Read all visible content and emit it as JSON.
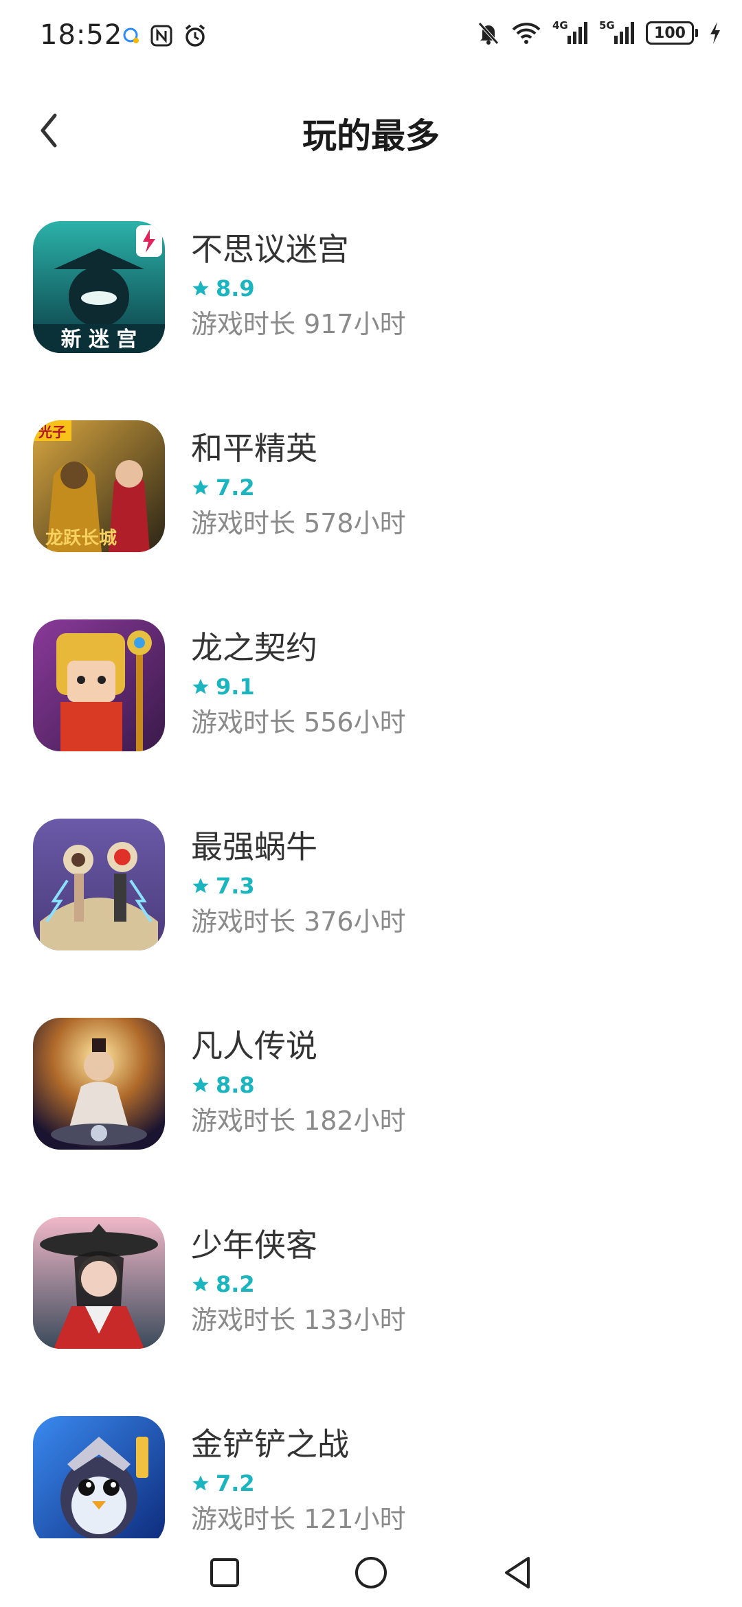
{
  "status_bar": {
    "time": "18:52",
    "network_4g": "4G",
    "network_5g": "5G",
    "battery": "100"
  },
  "header": {
    "title": "玩的最多"
  },
  "games": [
    {
      "name": "不思议迷宫",
      "rating": "8.9",
      "playtime": "游戏时长 917小时",
      "icon_colors": [
        "#1f8a86",
        "#0c3f45"
      ],
      "icon_text": "新 迷 宫"
    },
    {
      "name": "和平精英",
      "rating": "7.2",
      "playtime": "游戏时长 578小时",
      "icon_colors": [
        "#c99a2a",
        "#3a2b12"
      ],
      "icon_text": "龙跃长城"
    },
    {
      "name": "龙之契约",
      "rating": "9.1",
      "playtime": "游戏时长 556小时",
      "icon_colors": [
        "#7b3a8c",
        "#e8b23a"
      ],
      "icon_text": ""
    },
    {
      "name": "最强蜗牛",
      "rating": "7.3",
      "playtime": "游戏时长 376小时",
      "icon_colors": [
        "#6c5aa0",
        "#d9c8a0"
      ],
      "icon_text": ""
    },
    {
      "name": "凡人传说",
      "rating": "8.8",
      "playtime": "游戏时长 182小时",
      "icon_colors": [
        "#f0c060",
        "#2a2040"
      ],
      "icon_text": ""
    },
    {
      "name": "少年侠客",
      "rating": "8.2",
      "playtime": "游戏时长 133小时",
      "icon_colors": [
        "#e79ab0",
        "#3a4a5a"
      ],
      "icon_text": ""
    },
    {
      "name": "金铲铲之战",
      "rating": "7.2",
      "playtime": "游戏时长 121小时",
      "icon_colors": [
        "#2a6ad8",
        "#0d2a7a"
      ],
      "icon_text": ""
    }
  ],
  "colors": {
    "accent": "#1bb5bf",
    "title": "#1a1a1a",
    "secondary": "#8a8a8a"
  }
}
